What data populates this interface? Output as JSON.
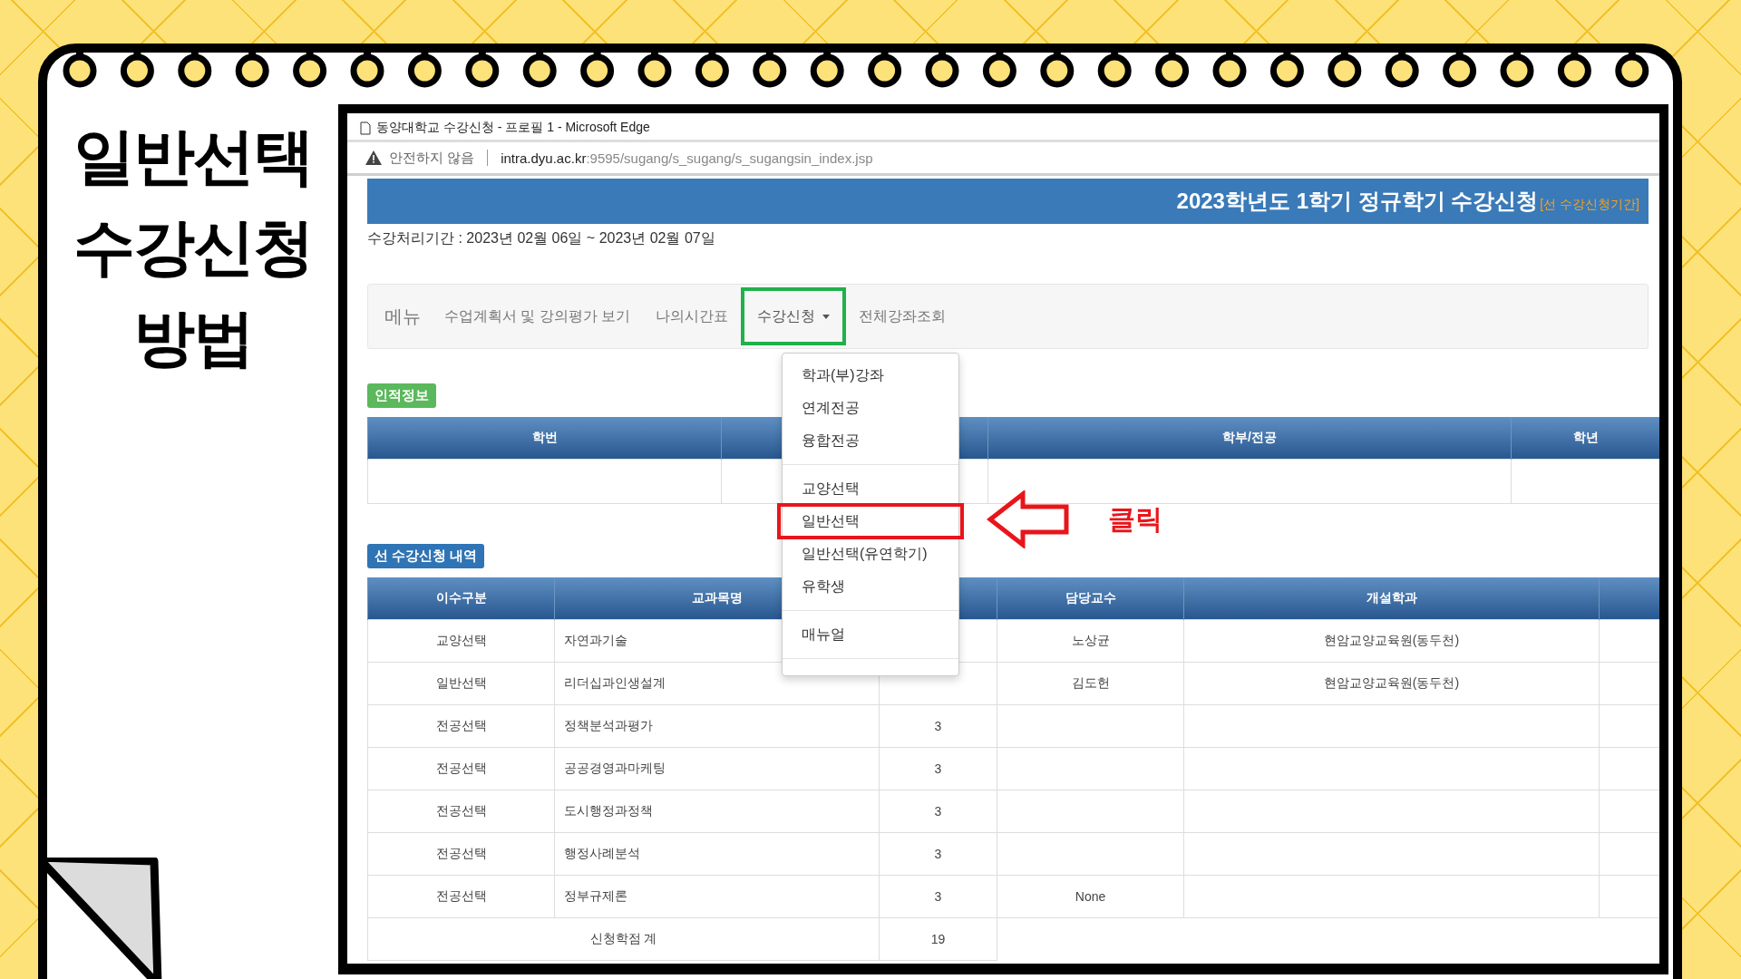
{
  "slide": {
    "title_lines": [
      "일반선택",
      "수강신청",
      "방법"
    ]
  },
  "browser": {
    "title": "동양대학교 수강신청 - 프로필 1 - Microsoft Edge",
    "security": "안전하지 않음",
    "url": "**intra.dyu.ac.kr**:9595/sugang/s_sugang/s_sugangsin_index.jsp"
  },
  "page": {
    "header": {
      "title": "2023학년도 1학기 정규학기 수강신청",
      "note": "[선 수강신청기간]"
    },
    "period": "수강처리기간 : 2023년 02월 06일 ~ 2023년 02월 07일",
    "nav": {
      "brand": "메뉴",
      "items": [
        {
          "label": "수업계획서 및 강의평가 보기",
          "dropdown": false,
          "highlighted": false
        },
        {
          "label": "나의시간표",
          "dropdown": false,
          "highlighted": false
        },
        {
          "label": "수강신청",
          "dropdown": true,
          "highlighted": true
        },
        {
          "label": "전체강좌조회",
          "dropdown": false,
          "highlighted": false
        }
      ]
    },
    "dropdown_menu": {
      "groups": [
        {
          "items": [
            {
              "label": "학과(부)강좌",
              "highlighted": false
            },
            {
              "label": "연계전공",
              "highlighted": false
            },
            {
              "label": "융합전공",
              "highlighted": false
            }
          ]
        },
        {
          "items": [
            {
              "label": "교양선택",
              "highlighted": false
            },
            {
              "label": "일반선택",
              "highlighted": true
            },
            {
              "label": "일반선택(유연학기)",
              "highlighted": false
            },
            {
              "label": "유학생",
              "highlighted": false
            }
          ]
        },
        {
          "items": [
            {
              "label": "매뉴얼",
              "highlighted": false
            }
          ]
        }
      ]
    },
    "personal_info": {
      "badge": "인적정보",
      "columns": [
        "학번",
        "학부/전공",
        "학년"
      ]
    },
    "course_list": {
      "badge": "선 수강신청 내역",
      "columns": [
        "이수구분",
        "교과목명",
        "담당교수",
        "개설학과"
      ],
      "rows": [
        {
          "category": "교양선택",
          "course": "자연과기술",
          "professor": "노상균",
          "department": "현암교양교육원(동두천)"
        },
        {
          "category": "일반선택",
          "course": "리더십과인생설계",
          "professor": "김도헌",
          "department": "현암교양교육원(동두천)"
        },
        {
          "category": "전공선택",
          "course": "정책분석과평가",
          "credits": "3"
        },
        {
          "category": "전공선택",
          "course": "공공경영과마케팅",
          "credits": "3"
        },
        {
          "category": "전공선택",
          "course": "도시행정과정책",
          "credits": "3"
        },
        {
          "category": "전공선택",
          "course": "행정사례분석",
          "credits": "3"
        },
        {
          "category": "전공선택",
          "course": "정부규제론",
          "credits": "3",
          "professor": "None"
        }
      ],
      "total": {
        "label": "신청학점 계",
        "credits": "19"
      }
    }
  },
  "annotation": {
    "label": "클릭"
  }
}
